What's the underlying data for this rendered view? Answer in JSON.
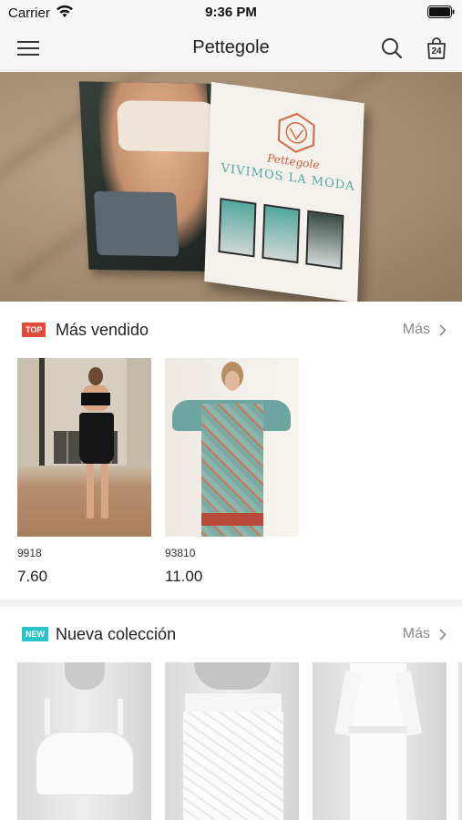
{
  "status_bar": {
    "carrier": "Carrier",
    "time": "9:36 PM"
  },
  "nav": {
    "title": "Pettegole",
    "bag_count": "24",
    "icons": [
      "menu-icon",
      "search-icon",
      "shopping-bag-icon"
    ]
  },
  "banner": {
    "magazine_logo": "Pettegole",
    "magazine_headline": "VIVIMOS LA MODA"
  },
  "sections": [
    {
      "badge": "TOP",
      "badge_color": "#e24a3b",
      "title": "Más vendido",
      "more": "Más",
      "products": [
        {
          "code": "9918",
          "price": "7.60"
        },
        {
          "code": "93810",
          "price": "11.00"
        }
      ]
    },
    {
      "badge": "NEW",
      "badge_color": "#29c4c9",
      "title": "Nueva colección",
      "more": "Más",
      "products": [
        {},
        {},
        {}
      ]
    }
  ]
}
